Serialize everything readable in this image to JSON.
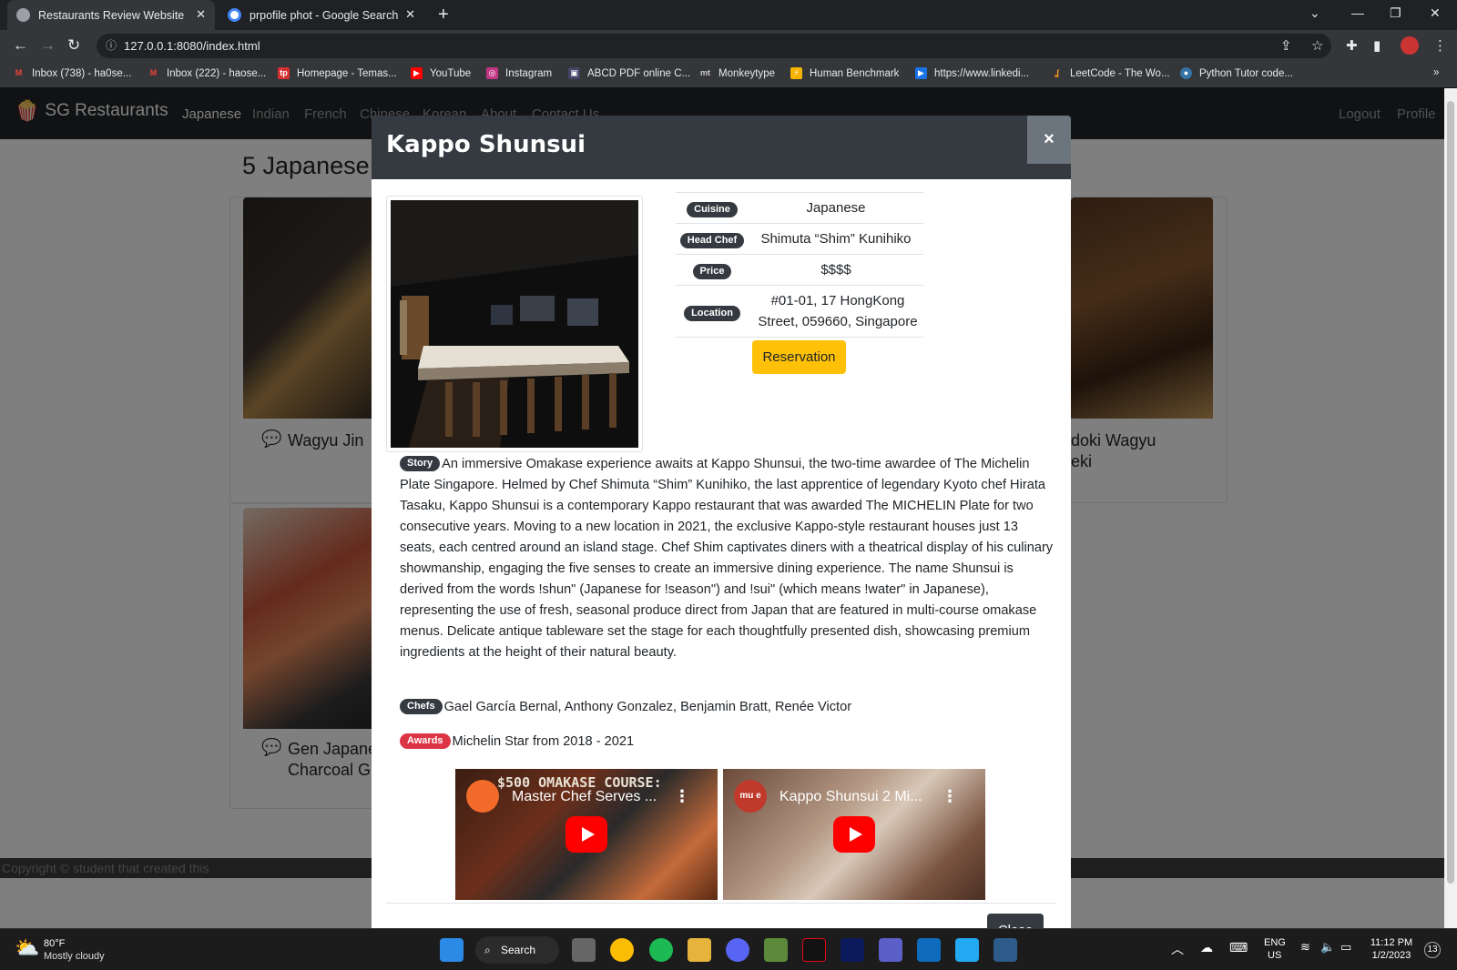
{
  "browser": {
    "tabs": [
      {
        "title": "Restaurants Review Website",
        "active": true
      },
      {
        "title": "prpofile phot - Google Search",
        "active": false
      }
    ],
    "url": "127.0.0.1:8080/index.html",
    "bookmarks": [
      "Inbox (738) - ha0se...",
      "Inbox (222) - haose...",
      "Homepage - Temas...",
      "YouTube",
      "Instagram",
      "ABCD PDF online C...",
      "Monkeytype",
      "Human Benchmark",
      "https://www.linkedi...",
      "LeetCode - The Wo...",
      "Python Tutor code..."
    ]
  },
  "site": {
    "brand": "SG Restaurants",
    "nav": [
      "Japanese",
      "Indian",
      "French",
      "Chinese",
      "Korean",
      "About",
      "Contact Us"
    ],
    "nav_right": [
      "Logout",
      "Profile"
    ],
    "heading": "5 Japanese",
    "cards": [
      {
        "title": "Wagyu Jin"
      },
      {
        "title": "doki Wagyu",
        "title2": "eki"
      },
      {
        "title": "Gen Japane",
        "title2": "Charcoal G"
      }
    ],
    "footer": "Copyright © student that created this"
  },
  "modal": {
    "title": "Kappo Shunsui",
    "close_x": "×",
    "info": [
      {
        "label": "Cuisine",
        "value": "Japanese"
      },
      {
        "label": "Head Chef",
        "value": "Shimuta “Shim” Kunihiko"
      },
      {
        "label": "Price",
        "value": "$$$$"
      },
      {
        "label": "Location",
        "value": "#01-01, 17 HongKong Street, 059660, Singapore"
      }
    ],
    "reservation": "Reservation",
    "story_label": "Story",
    "story": "An immersive Omakase experience awaits at Kappo Shunsui, the two-time awardee of The Michelin Plate Singapore. Helmed by Chef Shimuta “Shim” Kunihiko, the last apprentice of legendary Kyoto chef Hirata Tasaku, Kappo Shunsui is a contemporary Kappo restaurant that was awarded The MICHELIN Plate for two consecutive years. Moving to a new location in 2021, the exclusive Kappo-style restaurant houses just 13 seats, each centred around an island stage. Chef Shim captivates diners with a theatrical display of his culinary showmanship, engaging the five senses to create an immersive dining experience. The name Shunsui is derived from the words !shun\" (Japanese for !season\") and !sui\" (which means !water\" in Japanese), representing the use of fresh, seasonal produce direct from Japan that are featured in multi-course omakase menus. Delicate antique tableware set the stage for each thoughtfully presented dish, showcasing premium ingredients at the height of their natural beauty.",
    "chefs_label": "Chefs",
    "chefs": "Gael García Bernal, Anthony Gonzalez, Benjamin Bratt, Renée Victor",
    "awards_label": "Awards",
    "awards": "Michelin Star from 2018 - 2021",
    "videos": [
      {
        "title": "Master Chef Serves ...",
        "overlay": "$500 OMAKASE COURSE:"
      },
      {
        "title": "Kappo Shunsui 2 Mi...",
        "channel": "mu e"
      }
    ],
    "close": "Close"
  },
  "taskbar": {
    "weather_temp": "80°F",
    "weather_desc": "Mostly cloudy",
    "search": "Search",
    "lang1": "ENG",
    "lang2": "US",
    "time": "11:12 PM",
    "date": "1/2/2023",
    "badge": "13"
  }
}
